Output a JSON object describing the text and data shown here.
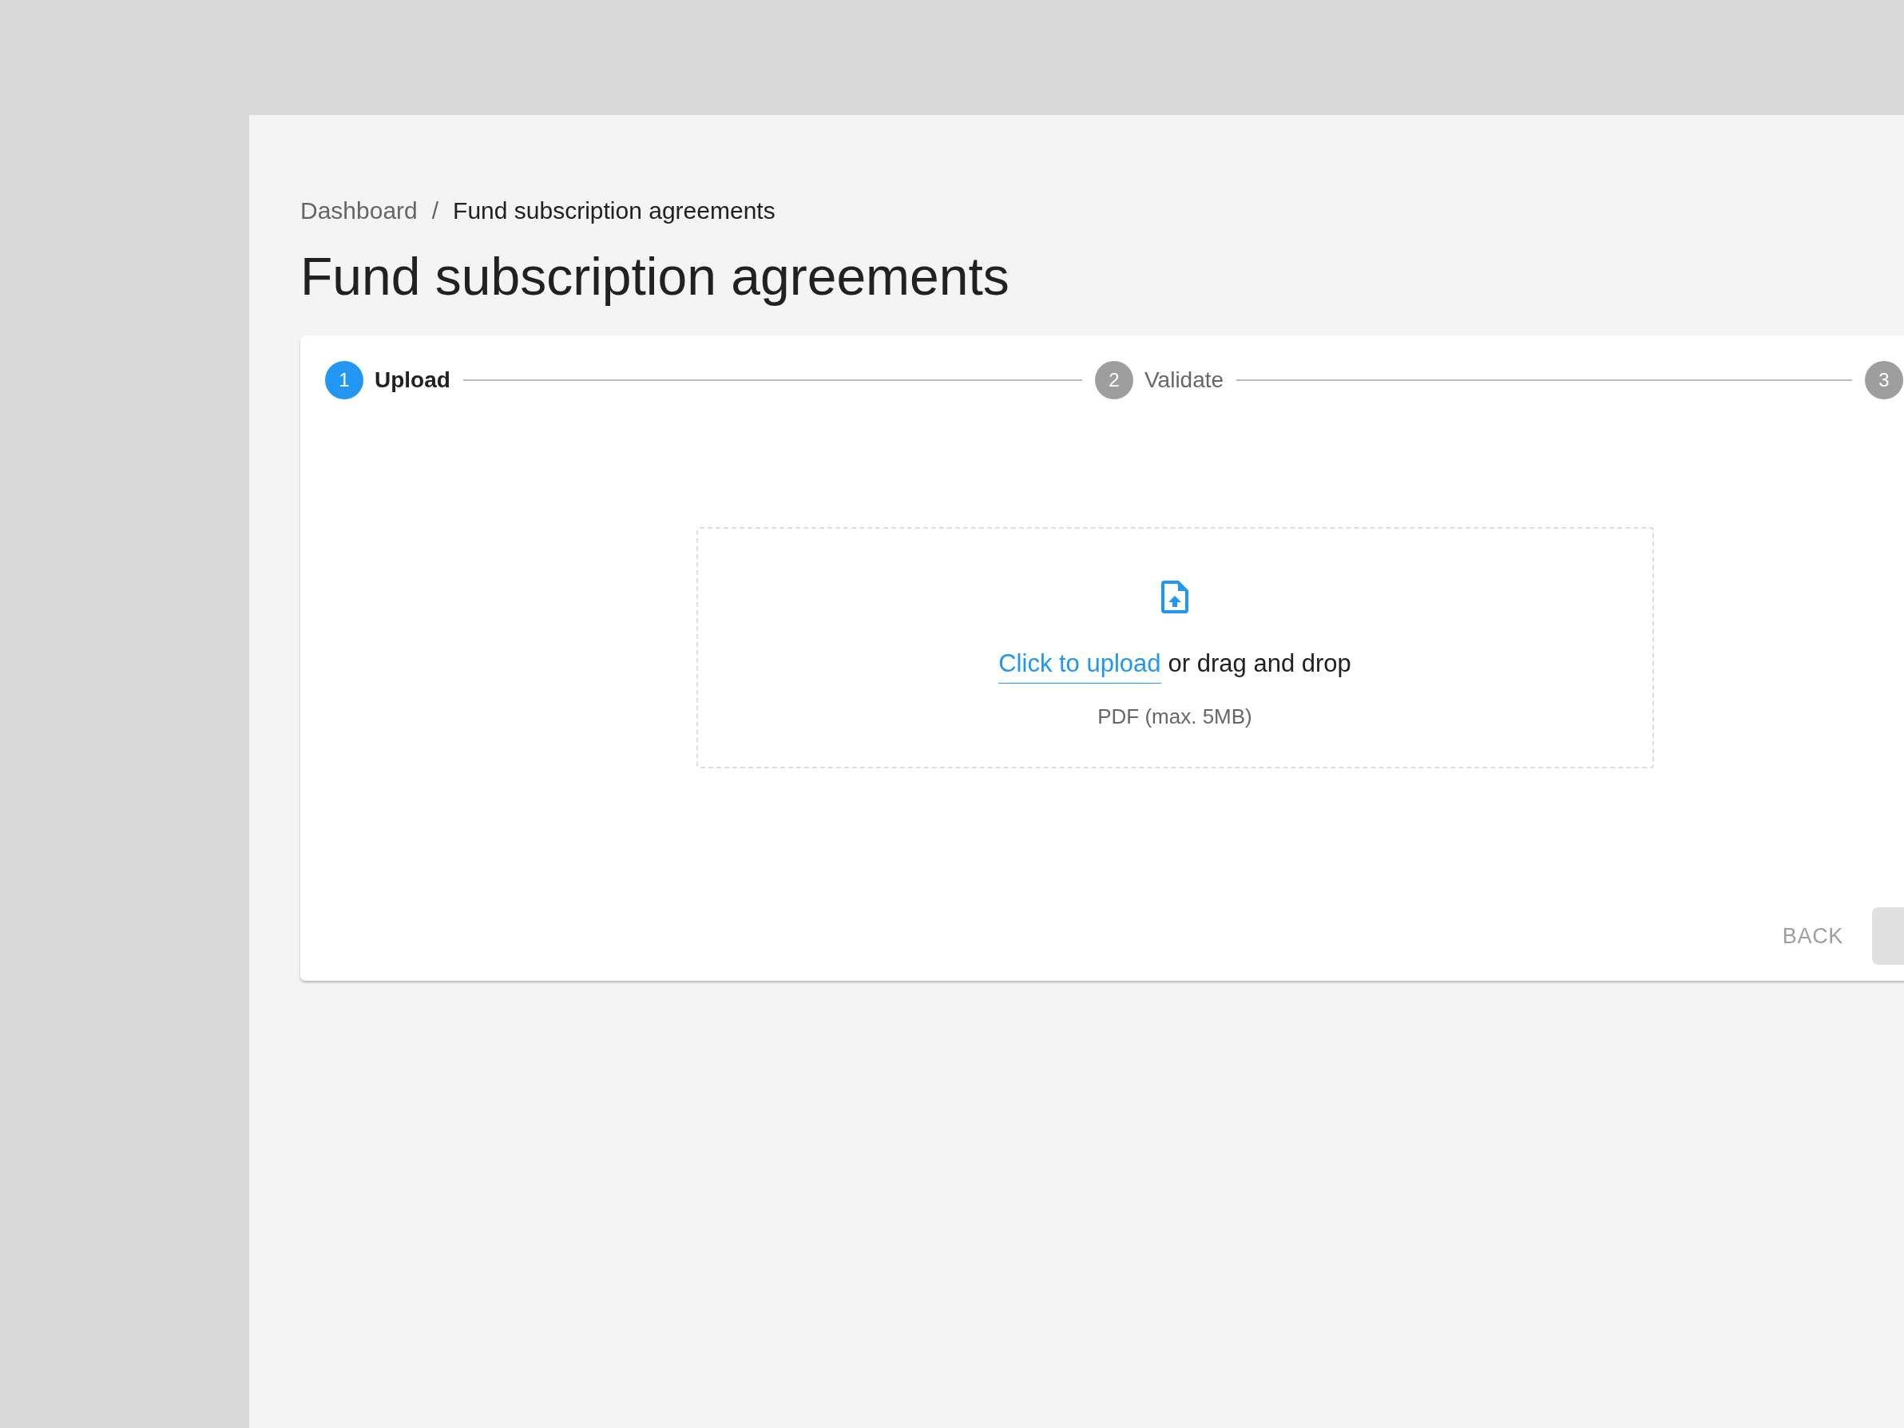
{
  "breadcrumb": [
    {
      "label": "Dashboard",
      "current": false
    },
    {
      "label": "Fund subscription agreements",
      "current": true
    }
  ],
  "breadcrumb_separator": "/",
  "title": "Fund subscription agreements",
  "steps": [
    {
      "number": "1",
      "label": "Upload",
      "selected": true
    },
    {
      "number": "2",
      "label": "Validate",
      "selected": false
    },
    {
      "number": "3",
      "selected": false
    }
  ],
  "upload": {
    "link": "Click to upload",
    "text": "or drag and drop",
    "hint": "PDF (max. 5MB)"
  },
  "buttons": [
    {
      "kind": "text",
      "label": "BACK",
      "disabled": true
    },
    {
      "kind": "contained",
      "disabled": true
    }
  ]
}
